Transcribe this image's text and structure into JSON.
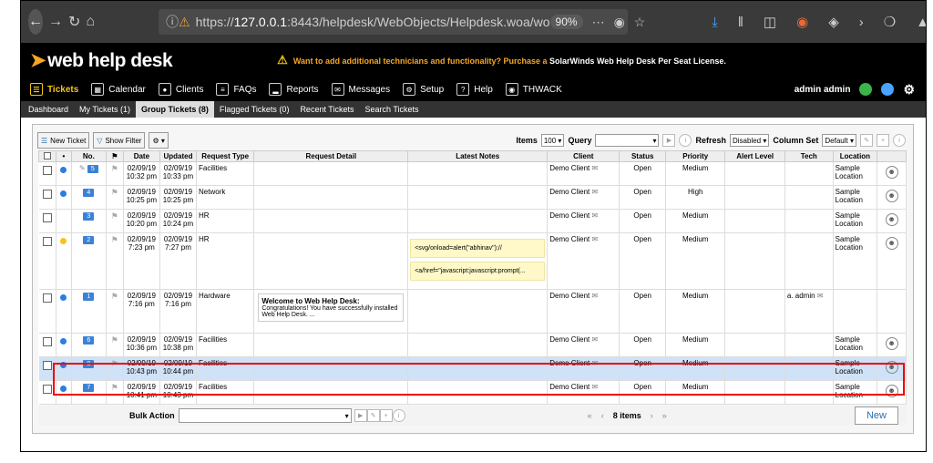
{
  "browser": {
    "url_prefix": "https://",
    "url_host": "127.0.0.1",
    "url_rest": ":8443/helpdesk/WebObjects/Helpdesk.woa/wo",
    "zoom": "90%"
  },
  "app": {
    "logo": "web help desk",
    "promo_lead": "Want to add additional technicians and functionality? Purchase a ",
    "promo_strong": "SolarWinds Web Help Desk Per Seat License.",
    "user": "admin admin"
  },
  "nav": [
    "Tickets",
    "Calendar",
    "Clients",
    "FAQs",
    "Reports",
    "Messages",
    "Setup",
    "Help",
    "THWACK"
  ],
  "tabs": [
    "Dashboard",
    "My Tickets (1)",
    "Group Tickets (8)",
    "Flagged Tickets (0)",
    "Recent Tickets",
    "Search Tickets"
  ],
  "toolbar": {
    "new_ticket": "New Ticket",
    "show_filter": "Show Filter",
    "items_label": "Items",
    "items_value": "100",
    "query_label": "Query",
    "refresh_label": "Refresh",
    "refresh_value": "Disabled",
    "column_set_label": "Column Set",
    "column_set_value": "Default"
  },
  "columns": [
    "No.",
    "Date",
    "Updated",
    "Request Type",
    "Request Detail",
    "Latest Notes",
    "Client",
    "Status",
    "Priority",
    "Alert Level",
    "Tech",
    "Location"
  ],
  "rows": [
    {
      "no": "5",
      "date": "02/09/19",
      "date_t": "10:32 pm",
      "upd": "02/09/19",
      "upd_t": "10:33 pm",
      "type": "Facilities",
      "client": "Demo Client",
      "status": "Open",
      "priority": "Medium",
      "loc1": "Sample",
      "loc2": "Location",
      "dot": "blue"
    },
    {
      "no": "4",
      "date": "02/09/19",
      "date_t": "10:25 pm",
      "upd": "02/09/19",
      "upd_t": "10:25 pm",
      "type": "Network",
      "client": "Demo Client",
      "status": "Open",
      "priority": "High",
      "loc1": "Sample",
      "loc2": "Location",
      "dot": "blue"
    },
    {
      "no": "3",
      "date": "02/09/19",
      "date_t": "10:20 pm",
      "upd": "02/09/19",
      "upd_t": "10:24 pm",
      "type": "HR",
      "client": "Demo Client",
      "status": "Open",
      "priority": "Medium",
      "loc1": "Sample",
      "loc2": "Location",
      "dot": ""
    },
    {
      "no": "2",
      "date": "02/09/19",
      "date_t": "7:23 pm",
      "upd": "02/09/19",
      "upd_t": "7:27 pm",
      "type": "HR",
      "client": "Demo Client",
      "status": "Open",
      "priority": "Medium",
      "loc1": "Sample",
      "loc2": "Location",
      "dot": "yellow",
      "note1": "<svg/onload=alert(\"abhinav\");//",
      "note2": "<a/href=\"javascript:javascript:prompt(..."
    },
    {
      "no": "1",
      "date": "02/09/19",
      "date_t": "7:16 pm",
      "upd": "02/09/19",
      "upd_t": "7:16 pm",
      "type": "Hardware",
      "client": "Demo Client",
      "status": "Open",
      "priority": "Medium",
      "tech": "a. admin",
      "dot": "blue",
      "detail_title": "Welcome to Web Help Desk:",
      "detail_body": "Congratulations! You have successfully installed Web Help Desk. ..."
    },
    {
      "no": "6",
      "date": "02/09/19",
      "date_t": "10:36 pm",
      "upd": "02/09/19",
      "upd_t": "10:38 pm",
      "type": "Facilities",
      "client": "Demo Client",
      "status": "Open",
      "priority": "Medium",
      "loc1": "Sample",
      "loc2": "Location",
      "dot": "blue"
    },
    {
      "no": "8",
      "date": "02/09/19",
      "date_t": "10:43 pm",
      "upd": "02/09/19",
      "upd_t": "10:44 pm",
      "type": "Facilities",
      "client": "Demo Client",
      "status": "Open",
      "priority": "Medium",
      "loc1": "Sample",
      "loc2": "Location",
      "dot": "blue",
      "selected": true
    },
    {
      "no": "7",
      "date": "02/09/19",
      "date_t": "10:41 pm",
      "upd": "02/09/19",
      "upd_t": "10:43 pm",
      "type": "Facilities",
      "client": "Demo Client",
      "status": "Open",
      "priority": "Medium",
      "loc1": "Sample",
      "loc2": "Location",
      "dot": "blue"
    }
  ],
  "bottom": {
    "bulk_action": "Bulk Action",
    "items_count": "8 items",
    "new_button": "New"
  }
}
